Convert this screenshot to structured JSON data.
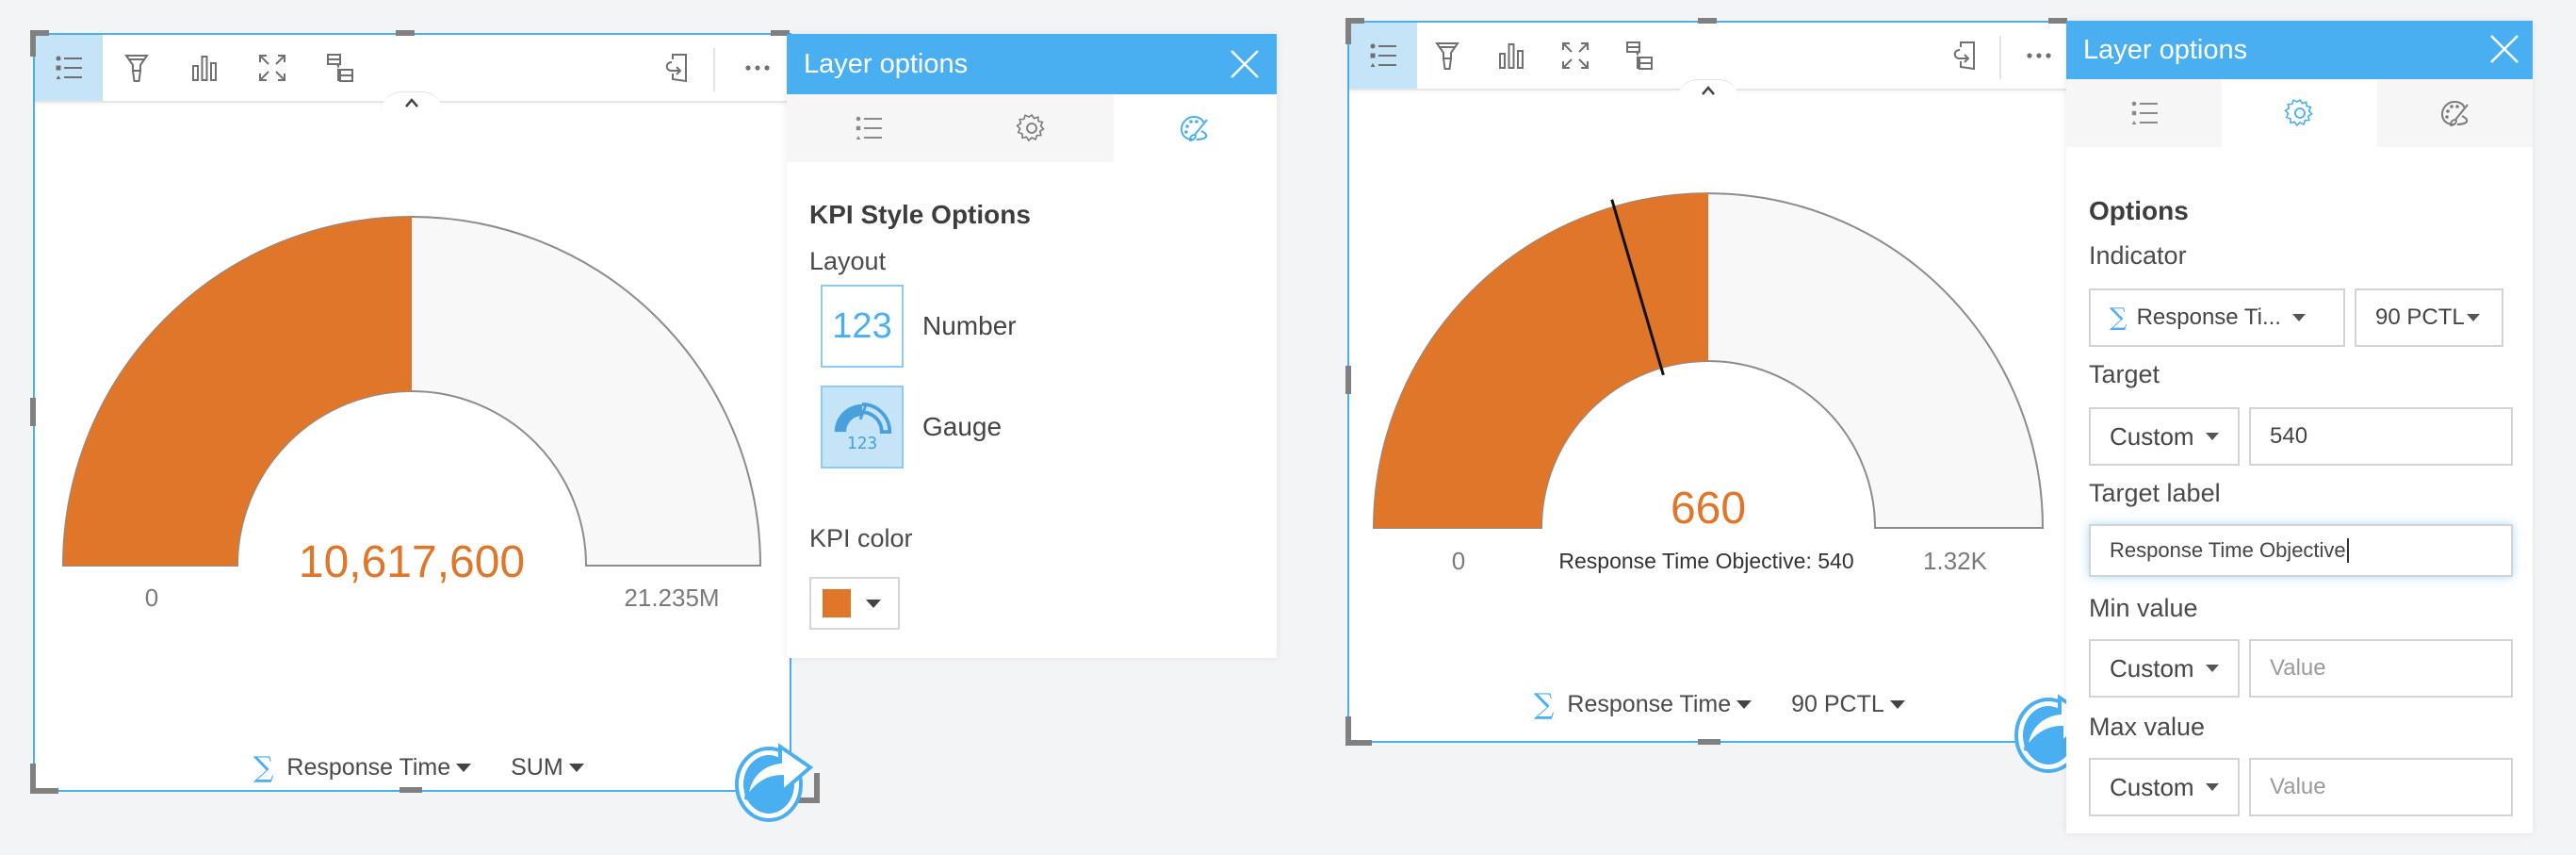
{
  "toolbar": {
    "buttons": [
      {
        "name": "layer-options",
        "icon": "legend-list-icon",
        "active": true
      },
      {
        "name": "filter",
        "icon": "filter-icon"
      },
      {
        "name": "visualization-type",
        "icon": "bar-chart-icon"
      },
      {
        "name": "maximize",
        "icon": "expand-icon"
      },
      {
        "name": "card-filter",
        "icon": "card-filter-icon"
      },
      {
        "name": "flip-card",
        "icon": "flip-card-icon"
      },
      {
        "name": "more",
        "icon": "more-dots-icon"
      }
    ]
  },
  "colors": {
    "accent": "#4aaff0",
    "kpi": "#e0762a",
    "gauge_track": "#f8f8f8",
    "selected_bg": "#c5e4f7"
  },
  "left_card": {
    "footer": {
      "field_label": "Response Time",
      "stat_label": "SUM"
    }
  },
  "right_card": {
    "footer": {
      "field_label": "Response Time",
      "stat_label": "90 PCTL"
    }
  },
  "left_panel": {
    "title": "Layer options",
    "tabs": [
      {
        "icon": "legend-list-icon",
        "active": false
      },
      {
        "icon": "gear-icon",
        "active": false
      },
      {
        "icon": "palette-icon",
        "active": true
      }
    ],
    "section_title": "KPI Style Options",
    "layout_label": "Layout",
    "layout_options": [
      {
        "label": "Number",
        "thumb_text": "123",
        "selected": false
      },
      {
        "label": "Gauge",
        "thumb_text": "123",
        "selected": true
      }
    ],
    "kpi_color_label": "KPI color",
    "kpi_color": "#e0762a"
  },
  "right_panel": {
    "title": "Layer options",
    "tabs": [
      {
        "icon": "legend-list-icon",
        "active": false
      },
      {
        "icon": "gear-icon",
        "active": true
      },
      {
        "icon": "palette-icon",
        "active": false
      }
    ],
    "section_title": "Options",
    "indicator": {
      "label": "Indicator",
      "field_value": "Response Ti...",
      "stat_value": "90 PCTL"
    },
    "target": {
      "label": "Target",
      "type_value": "Custom",
      "value": "540"
    },
    "target_label": {
      "label": "Target label",
      "value": "Response Time Objective"
    },
    "min_value": {
      "label": "Min value",
      "type_value": "Custom",
      "placeholder": "Value"
    },
    "max_value": {
      "label": "Max value",
      "type_value": "Custom",
      "placeholder": "Value"
    }
  },
  "chart_data": [
    {
      "type": "gauge",
      "title": "",
      "value": 10617600,
      "value_label": "10,617,600",
      "min": 0,
      "max": 21235000,
      "min_label": "0",
      "max_label": "21.235M",
      "fill_fraction": 0.5,
      "color": "#e0762a"
    },
    {
      "type": "gauge",
      "title": "",
      "value": 660,
      "value_label": "660",
      "min": 0,
      "max": 1320,
      "min_label": "0",
      "max_label": "1.32K",
      "fill_fraction": 0.5,
      "target": 540,
      "target_label": "Response Time Objective: 540",
      "color": "#e0762a"
    }
  ]
}
